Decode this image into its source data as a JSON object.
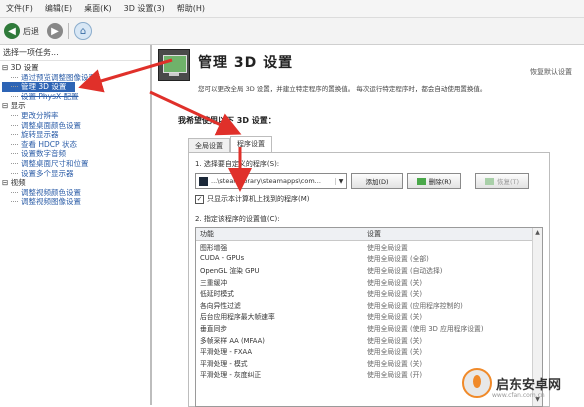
{
  "menu": [
    "文件(F)",
    "编辑(E)",
    "桌面(K)",
    "3D 设置(3)",
    "帮助(H)"
  ],
  "toolbar": {
    "back_label": "后退"
  },
  "left_panel": {
    "task_header": "选择一项任务...",
    "tree": [
      {
        "type": "cat",
        "label": "3D 设置"
      },
      {
        "type": "item",
        "label": "通过预览调整图像设置"
      },
      {
        "type": "item",
        "label": "管理 3D 设置",
        "selected": true
      },
      {
        "type": "item",
        "label": "设置 PhysX 配置",
        "struck": true
      },
      {
        "type": "cat",
        "label": "显示"
      },
      {
        "type": "item",
        "label": "更改分辨率"
      },
      {
        "type": "item",
        "label": "调整桌面颜色设置"
      },
      {
        "type": "item",
        "label": "旋转显示器"
      },
      {
        "type": "item",
        "label": "查看 HDCP 状态"
      },
      {
        "type": "item",
        "label": "设置数字音频"
      },
      {
        "type": "item",
        "label": "调整桌面尺寸和位置"
      },
      {
        "type": "item",
        "label": "设置多个显示器"
      },
      {
        "type": "cat",
        "label": "视频"
      },
      {
        "type": "item",
        "label": "调整视频颜色设置"
      },
      {
        "type": "item",
        "label": "调整视频图像设置"
      }
    ]
  },
  "main": {
    "title": "管理 3D 设置",
    "restore_defaults": "恢复默认设置",
    "description": "您可以更改全局 3D 设置，并建立特定程序的置换值。 每次运行特定程序时，都会自动使用置换值。",
    "section_title": "我希望使用以下 3D 设置：",
    "tabs": [
      "全局设置",
      "程序设置"
    ],
    "active_tab": 1,
    "select_label": "1. 选择要自定义的程序(S):",
    "program_value": "...\\steamlibrary\\steamapps\\com...",
    "add_button": "添加(D)",
    "remove_button": "删除(R)",
    "restore_button": "恢复(T)",
    "show_only_checkbox": "只显示本计算机上找到的程序(M)",
    "settings_label": "2. 指定该程序的设置值(C):",
    "table_headers": [
      "功能",
      "设置"
    ],
    "table_rows": [
      [
        "图形增强",
        "使用全局设置"
      ],
      [
        "CUDA - GPUs",
        "使用全局设置 (全部)"
      ],
      [
        "OpenGL 渲染 GPU",
        "使用全局设置 (自动选择)"
      ],
      [
        "三重缓冲",
        "使用全局设置 (关)"
      ],
      [
        "低延时模式",
        "使用全局设置 (关)"
      ],
      [
        "各向异性过滤",
        "使用全局设置 (应用程序控制的)"
      ],
      [
        "后台应用程序最大帧速率",
        "使用全局设置 (关)"
      ],
      [
        "垂直同步",
        "使用全局设置 (使用 3D 应用程序设置)"
      ],
      [
        "多帧采样 AA (MFAA)",
        "使用全局设置 (关)"
      ],
      [
        "平滑处理 - FXAA",
        "使用全局设置 (关)"
      ],
      [
        "平滑处理 - 模式",
        "使用全局设置 (关)"
      ],
      [
        "平滑处理 - 灰度纠正",
        "使用全局设置 (开)"
      ]
    ]
  },
  "watermark": {
    "text": "启东安卓网",
    "url": "www.cfan.com.cn"
  },
  "colors": {
    "selection": "#2d64b5",
    "arrow": "#e0302a",
    "nvidia_green": "#76b900"
  }
}
